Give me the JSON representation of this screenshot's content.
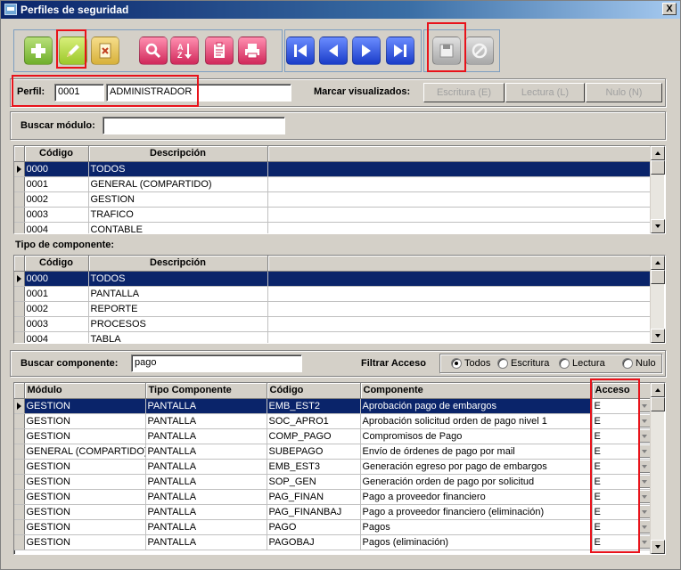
{
  "window": {
    "title": "Perfiles de seguridad",
    "close_label": "X"
  },
  "toolbar": {
    "buttons": [
      {
        "name": "add-button",
        "icon": "plus-icon"
      },
      {
        "name": "edit-button",
        "icon": "pencil-icon"
      },
      {
        "name": "delete-button",
        "icon": "delete-document-icon"
      },
      {
        "name": "search-button",
        "icon": "magnifier-icon"
      },
      {
        "name": "sort-button",
        "icon": "sort-az-icon"
      },
      {
        "name": "report-button",
        "icon": "clipboard-icon"
      },
      {
        "name": "print-button",
        "icon": "printer-icon"
      },
      {
        "name": "first-record-button",
        "icon": "first-icon"
      },
      {
        "name": "previous-record-button",
        "icon": "previous-icon"
      },
      {
        "name": "next-record-button",
        "icon": "next-icon"
      },
      {
        "name": "last-record-button",
        "icon": "last-icon"
      },
      {
        "name": "save-button",
        "icon": "save-icon"
      },
      {
        "name": "cancel-button",
        "icon": "cancel-icon"
      }
    ]
  },
  "perfil": {
    "label": "Perfil:",
    "code": "0001",
    "name": "ADMINISTRADOR"
  },
  "marcar": {
    "label": "Marcar visualizados:",
    "buttons": [
      "Escritura (E)",
      "Lectura (L)",
      "Nulo (N)"
    ]
  },
  "buscar_modulo": {
    "label": "Buscar módulo:",
    "value": ""
  },
  "modulos": {
    "columns": [
      "Código",
      "Descripción"
    ],
    "rows": [
      [
        "0000",
        "TODOS"
      ],
      [
        "0001",
        "GENERAL (COMPARTIDO)"
      ],
      [
        "0002",
        "GESTION"
      ],
      [
        "0003",
        "TRAFICO"
      ],
      [
        "0004",
        "CONTABLE"
      ]
    ]
  },
  "tipo_componente": {
    "label": "Tipo de componente:",
    "columns": [
      "Código",
      "Descripción"
    ],
    "rows": [
      [
        "0000",
        "TODOS"
      ],
      [
        "0001",
        "PANTALLA"
      ],
      [
        "0002",
        "REPORTE"
      ],
      [
        "0003",
        "PROCESOS"
      ],
      [
        "0004",
        "TABLA"
      ]
    ]
  },
  "buscar_componente": {
    "label": "Buscar componente:",
    "value": "pago"
  },
  "filtrar_acceso": {
    "label": "Filtrar Acceso",
    "options": [
      "Todos",
      "Escritura",
      "Lectura",
      "Nulo"
    ],
    "selected": "Todos"
  },
  "componentes": {
    "columns": [
      "Módulo",
      "Tipo Componente",
      "Código",
      "Componente",
      "Acceso"
    ],
    "rows": [
      [
        "GESTION",
        "PANTALLA",
        "EMB_EST2",
        "Aprobación pago de embargos",
        "E"
      ],
      [
        "GESTION",
        "PANTALLA",
        "SOC_APRO1",
        "Aprobación solicitud orden de pago nivel 1",
        "E"
      ],
      [
        "GESTION",
        "PANTALLA",
        "COMP_PAGO",
        "Compromisos de Pago",
        "E"
      ],
      [
        "GENERAL (COMPARTIDO)",
        "PANTALLA",
        "SUBEPAGO",
        "Envío de órdenes de pago por mail",
        "E"
      ],
      [
        "GESTION",
        "PANTALLA",
        "EMB_EST3",
        "Generación egreso por pago de embargos",
        "E"
      ],
      [
        "GESTION",
        "PANTALLA",
        "SOP_GEN",
        "Generación orden de pago por solicitud",
        "E"
      ],
      [
        "GESTION",
        "PANTALLA",
        "PAG_FINAN",
        "Pago a proveedor financiero",
        "E"
      ],
      [
        "GESTION",
        "PANTALLA",
        "PAG_FINANBAJ",
        "Pago a proveedor financiero (eliminación)",
        "E"
      ],
      [
        "GESTION",
        "PANTALLA",
        "PAGO",
        "Pagos",
        "E"
      ],
      [
        "GESTION",
        "PANTALLA",
        "PAGOBAJ",
        "Pagos (eliminación)",
        "E"
      ]
    ]
  }
}
